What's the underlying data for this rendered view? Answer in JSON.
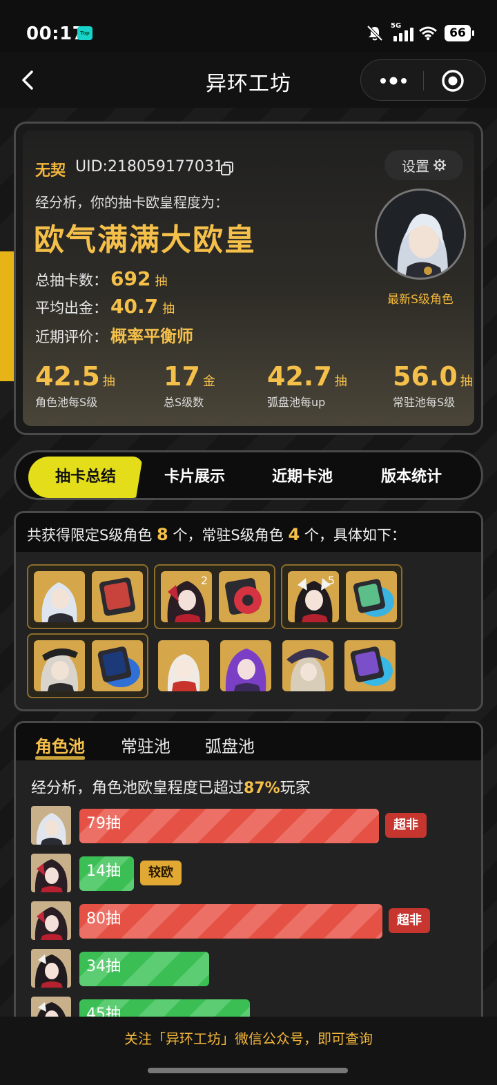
{
  "status": {
    "time": "00:17",
    "app_badge": "Top",
    "network": "5G",
    "battery": "66"
  },
  "nav": {
    "title": "异环工坊"
  },
  "profile": {
    "name": "无契",
    "uid": "UID:218059177031",
    "settings_label": "设置",
    "analysis_label": "经分析，你的抽卡欧皇程度为：",
    "luck_title": "欧气满满大欧皇",
    "total_label": "总抽卡数：",
    "total_value": "692",
    "total_unit": "抽",
    "avg_label": "平均出金：",
    "avg_value": "40.7",
    "avg_unit": "抽",
    "rating_label": "近期评价：",
    "rating_value": "概率平衡师",
    "latest_label": "最新S级角色",
    "stats": [
      {
        "num": "42.5",
        "unit": "抽",
        "label": "角色池每S级"
      },
      {
        "num": "17",
        "unit": "金",
        "label": "总S级数"
      },
      {
        "num": "42.7",
        "unit": "抽",
        "label": "弧盘池每up"
      },
      {
        "num": "56.0",
        "unit": "抽",
        "label": "常驻池每S级"
      }
    ]
  },
  "tabs": [
    "抽卡总结",
    "卡片展示",
    "近期卡池",
    "版本统计"
  ],
  "characters": {
    "summary_a": "共获得限定S级角色",
    "limited_count": "8",
    "summary_b": "个，常驻S级角色",
    "standard_count": "4",
    "summary_c": "个，具体如下：",
    "badge_2": "2",
    "badge_5": "5"
  },
  "pool": {
    "tabs": [
      "角色池",
      "常驻池",
      "弧盘池"
    ],
    "analysis_a": "经分析，角色池欧皇程度已超过",
    "analysis_pct": "87%",
    "analysis_b": "玩家",
    "rows": [
      {
        "label": "79抽",
        "tag": "超非"
      },
      {
        "label": "14抽",
        "tag": "较欧"
      },
      {
        "label": "80抽",
        "tag": "超非"
      },
      {
        "label": "34抽",
        "tag": ""
      },
      {
        "label": "45抽",
        "tag": ""
      }
    ]
  },
  "footer": {
    "text": "关注「异环工坊」微信公众号，即可查询"
  },
  "colors": {
    "accent_gold": "#f5c04a",
    "tab_yellow": "#e3dd1a",
    "bar_red": "#e55245",
    "bar_green": "#3bbf55"
  }
}
